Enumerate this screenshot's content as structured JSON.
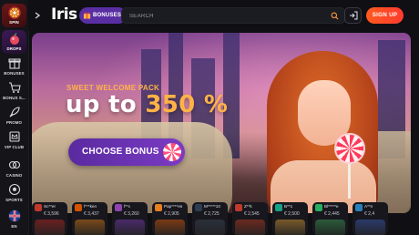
{
  "sidebar": {
    "items": [
      {
        "label": "SPIN",
        "icon": "spin-wheel-icon"
      },
      {
        "label": "DROPS",
        "icon": "drops-icon"
      },
      {
        "label": "BONUSES",
        "icon": "gift-icon"
      },
      {
        "label": "BONUS S...",
        "icon": "cart-icon"
      },
      {
        "label": "PROMO",
        "icon": "rocket-icon"
      },
      {
        "label": "VIP CLUB",
        "icon": "crown-icon"
      },
      {
        "label": "CASINO",
        "icon": "casino-chips-icon"
      },
      {
        "label": "SPORTS",
        "icon": "soccer-ball-icon"
      },
      {
        "label": "EN",
        "icon": "uk-flag-icon"
      }
    ]
  },
  "header": {
    "logo_text": "Iris",
    "bonuses_label": "BONUSES",
    "search_placeholder": "SEARCH",
    "signup_label": "SIGN UP"
  },
  "banner": {
    "welcome_text": "SWEET WELCOME PACK",
    "headline_prefix": "up to ",
    "headline_value": "350 %",
    "cta_label": "CHOOSE BONUS"
  },
  "winners": [
    {
      "name": "Sc**er",
      "amount": "€ 3,596",
      "thumb": "#c0392b",
      "img": "#6b1f1f"
    },
    {
      "name": "f***ken",
      "amount": "€ 3,437",
      "thumb": "#d35400",
      "img": "#7a4a1a"
    },
    {
      "name": "f**c",
      "amount": "€ 3,260",
      "thumb": "#8e44ad",
      "img": "#4a2a6b"
    },
    {
      "name": "Pap****es",
      "amount": "€ 2,905",
      "thumb": "#e67e22",
      "img": "#7a3a14"
    },
    {
      "name": "M*****10",
      "amount": "€ 2,725",
      "thumb": "#2c3e50",
      "img": "#2a2f3a"
    },
    {
      "name": "Z**k",
      "amount": "€ 2,545",
      "thumb": "#c0392b",
      "img": "#6b2a1f"
    },
    {
      "name": "B**1",
      "amount": "€ 2,500",
      "thumb": "#16a085",
      "img": "#7a5a2a"
    },
    {
      "name": "Bl*****e",
      "amount": "€ 2,445",
      "thumb": "#27ae60",
      "img": "#2a5a3a"
    },
    {
      "name": "A**n",
      "amount": "€ 2,4",
      "thumb": "#2980b9",
      "img": "#2a3a6b"
    }
  ],
  "colors": {
    "accent_orange": "#ff5a1f",
    "accent_purple": "#5a2ea3",
    "highlight_yellow": "#ffb347",
    "background": "#0f0f14"
  }
}
